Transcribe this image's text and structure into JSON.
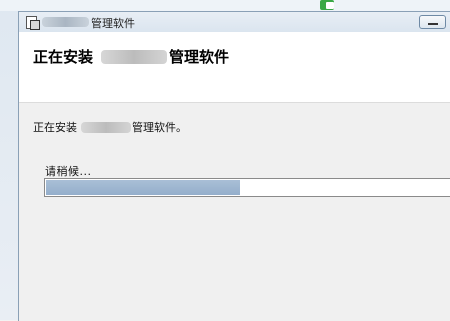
{
  "window": {
    "title": "管理软件",
    "app_icon": "installer-icon"
  },
  "header": {
    "heading_prefix": "正在安装",
    "heading_suffix": "管理软件"
  },
  "body": {
    "status_prefix": "正在安装",
    "status_suffix": "管理软件。",
    "wait_text": "请稍候..."
  },
  "progress": {
    "fraction": 0.48
  },
  "colors": {
    "progress_fill": "#9db5d0"
  }
}
